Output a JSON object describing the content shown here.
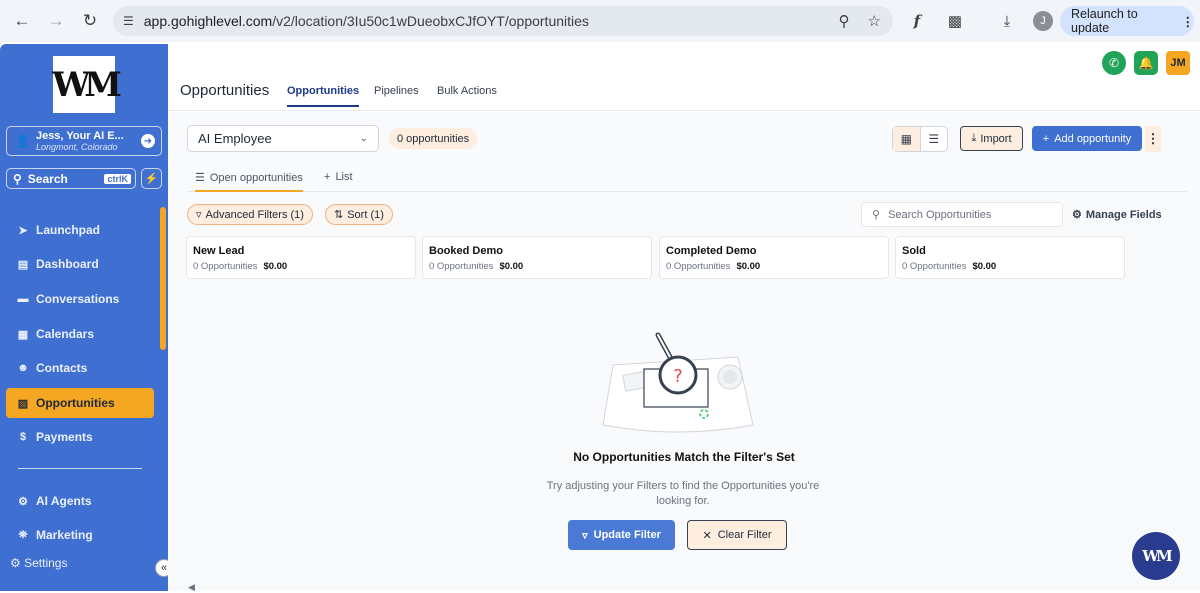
{
  "browser": {
    "url_host": "app.gohighlevel.com",
    "url_path": "/v2/location/3Iu50c1wDueobxCJfOYT/opportunities",
    "relaunch_label": "Relaunch to update",
    "profile_initial": "J"
  },
  "sidebar": {
    "account_name": "Jess, Your AI E...",
    "account_location": "Longmont, Colorado",
    "search_label": "Search",
    "search_shortcut": "ctrlK",
    "items": [
      {
        "label": "Launchpad",
        "icon": "rocket-icon"
      },
      {
        "label": "Dashboard",
        "icon": "chart-icon"
      },
      {
        "label": "Conversations",
        "icon": "chat-icon"
      },
      {
        "label": "Calendars",
        "icon": "calendar-icon"
      },
      {
        "label": "Contacts",
        "icon": "contacts-icon"
      },
      {
        "label": "Opportunities",
        "icon": "opportunities-icon"
      },
      {
        "label": "Payments",
        "icon": "dollar-icon"
      },
      {
        "label": "AI Agents",
        "icon": "robot-icon"
      },
      {
        "label": "Marketing",
        "icon": "cart-icon"
      }
    ],
    "settings_label": "Settings"
  },
  "topbar": {
    "user_initials": "JM"
  },
  "header": {
    "title": "Opportunities",
    "tabs": [
      "Opportunities",
      "Pipelines",
      "Bulk Actions"
    ]
  },
  "toolbar": {
    "pipeline_select": "AI Employee",
    "count_label": "0 opportunities",
    "import_label": "Import",
    "add_label": "Add opportunity"
  },
  "subtabs": {
    "open_label": "Open opportunities",
    "list_label": "List"
  },
  "filters": {
    "advanced_label": "Advanced Filters (1)",
    "sort_label": "Sort (1)",
    "search_placeholder": "Search Opportunities",
    "manage_fields_label": "Manage Fields"
  },
  "stages": [
    {
      "name": "New Lead",
      "count": "0 Opportunities",
      "amount": "$0.00"
    },
    {
      "name": "Booked Demo",
      "count": "0 Opportunities",
      "amount": "$0.00"
    },
    {
      "name": "Completed Demo",
      "count": "0 Opportunities",
      "amount": "$0.00"
    },
    {
      "name": "Sold",
      "count": "0 Opportunities",
      "amount": "$0.00"
    }
  ],
  "empty_state": {
    "title": "No Opportunities Match the Filter's Set",
    "description": "Try adjusting your Filters to find the Opportunities you're looking for.",
    "update_label": "Update Filter",
    "clear_label": "Clear Filter"
  },
  "colors": {
    "accent": "#3f6fd0",
    "highlight": "#f5a623",
    "peach": "#fdeee0"
  }
}
